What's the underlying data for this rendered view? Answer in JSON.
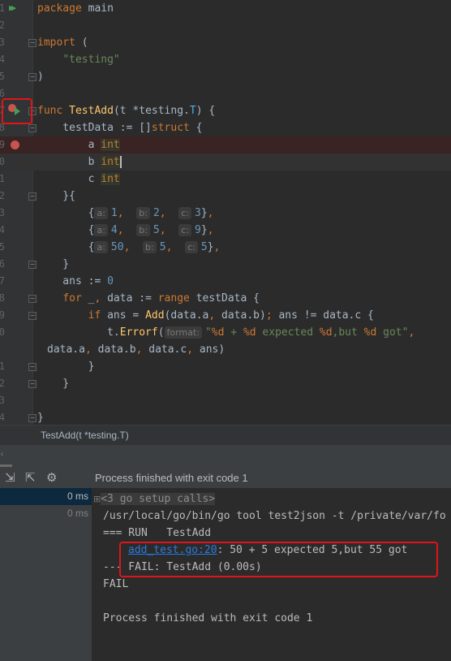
{
  "editor": {
    "lines": [
      {
        "num": "1",
        "tokens": [
          [
            "package ",
            "k"
          ],
          [
            "main",
            "t"
          ]
        ]
      },
      {
        "num": "2",
        "tokens": []
      },
      {
        "num": "3",
        "tokens": [
          [
            "import ",
            "k"
          ],
          [
            "(",
            "t"
          ]
        ]
      },
      {
        "num": "4",
        "tokens": [
          [
            "    ",
            "t"
          ],
          [
            "\"testing\"",
            "s"
          ]
        ]
      },
      {
        "num": "5",
        "tokens": [
          [
            ")",
            "t"
          ]
        ]
      },
      {
        "num": "6",
        "tokens": []
      },
      {
        "num": "7",
        "tokens": [
          [
            "func ",
            "k"
          ],
          [
            "TestAdd",
            "f"
          ],
          [
            "(t *testing.",
            "t"
          ],
          [
            "T",
            "tt"
          ],
          [
            ") {",
            "t"
          ]
        ]
      },
      {
        "num": "8",
        "tokens": [
          [
            "    testData := []",
            "t"
          ],
          [
            "struct",
            "k"
          ],
          [
            " {",
            "t"
          ]
        ]
      },
      {
        "num": "9",
        "tokens": [
          [
            "        a ",
            "t"
          ],
          [
            "int",
            "ty"
          ]
        ]
      },
      {
        "num": "0",
        "tokens": [
          [
            "        b ",
            "t"
          ],
          [
            "int",
            "ty"
          ]
        ]
      },
      {
        "num": "1",
        "tokens": [
          [
            "        c ",
            "t"
          ],
          [
            "int",
            "ty"
          ]
        ]
      },
      {
        "num": "2",
        "tokens": [
          [
            "    }{",
            "t"
          ]
        ]
      },
      {
        "num": "3",
        "tokens": [
          [
            "        {",
            "t"
          ],
          [
            "a:",
            "h"
          ],
          [
            "1",
            "n"
          ],
          [
            ",  ",
            "k"
          ],
          [
            "b:",
            "h"
          ],
          [
            "2",
            "n"
          ],
          [
            ",  ",
            "k"
          ],
          [
            "c:",
            "h"
          ],
          [
            "3",
            "n"
          ],
          [
            "}",
            "t"
          ],
          [
            ",",
            "k"
          ]
        ]
      },
      {
        "num": "4",
        "tokens": [
          [
            "        {",
            "t"
          ],
          [
            "a:",
            "h"
          ],
          [
            "4",
            "n"
          ],
          [
            ",  ",
            "k"
          ],
          [
            "b:",
            "h"
          ],
          [
            "5",
            "n"
          ],
          [
            ",  ",
            "k"
          ],
          [
            "c:",
            "h"
          ],
          [
            "9",
            "n"
          ],
          [
            "}",
            "t"
          ],
          [
            ",",
            "k"
          ]
        ]
      },
      {
        "num": "5",
        "tokens": [
          [
            "        {",
            "t"
          ],
          [
            "a:",
            "h"
          ],
          [
            "50",
            "n"
          ],
          [
            ",  ",
            "k"
          ],
          [
            "b:",
            "h"
          ],
          [
            "5",
            "n"
          ],
          [
            ",  ",
            "k"
          ],
          [
            "c:",
            "h"
          ],
          [
            "5",
            "n"
          ],
          [
            "}",
            "t"
          ],
          [
            ",",
            "k"
          ]
        ]
      },
      {
        "num": "6",
        "tokens": [
          [
            "    }",
            "t"
          ]
        ]
      },
      {
        "num": "7",
        "tokens": [
          [
            "    ans := ",
            "t"
          ],
          [
            "0",
            "n"
          ]
        ]
      },
      {
        "num": "8",
        "tokens": [
          [
            "    ",
            "t"
          ],
          [
            "for ",
            "k"
          ],
          [
            "_",
            "t"
          ],
          [
            ", ",
            "k"
          ],
          [
            "data := ",
            "t"
          ],
          [
            "range ",
            "k"
          ],
          [
            "testData {",
            "t"
          ]
        ]
      },
      {
        "num": "9",
        "tokens": [
          [
            "        ",
            "t"
          ],
          [
            "if ",
            "k"
          ],
          [
            "ans = ",
            "t"
          ],
          [
            "Add",
            "f"
          ],
          [
            "(data.a",
            "t"
          ],
          [
            ", ",
            "k"
          ],
          [
            "data.b)",
            "t"
          ],
          [
            "; ",
            "k"
          ],
          [
            "ans != data.c {",
            "t"
          ]
        ]
      },
      {
        "num": "0",
        "tokens": [
          [
            "           t.",
            "t"
          ],
          [
            "Errorf",
            "f"
          ],
          [
            "(",
            "t"
          ],
          [
            "format:",
            "h"
          ],
          [
            "\"",
            "s"
          ],
          [
            "%d",
            "k"
          ],
          [
            " + ",
            "s"
          ],
          [
            "%d",
            "k"
          ],
          [
            " expected ",
            "s"
          ],
          [
            "%d",
            "k"
          ],
          [
            ",but ",
            "s"
          ],
          [
            "%d",
            "k"
          ],
          [
            " got\"",
            "s"
          ],
          [
            ",",
            "k"
          ]
        ]
      },
      {
        "num": "",
        "wrap": true,
        "tokens": [
          [
            "data.a",
            "t"
          ],
          [
            ", ",
            "k"
          ],
          [
            "data.b",
            "t"
          ],
          [
            ", ",
            "k"
          ],
          [
            "data.c",
            "t"
          ],
          [
            ", ",
            "k"
          ],
          [
            "ans)",
            "t"
          ]
        ]
      },
      {
        "num": "1",
        "tokens": [
          [
            "        }",
            "t"
          ]
        ]
      },
      {
        "num": "2",
        "tokens": [
          [
            "    }",
            "t"
          ]
        ]
      },
      {
        "num": "3",
        "tokens": []
      },
      {
        "num": "4",
        "tokens": [
          [
            "}",
            "t"
          ]
        ]
      }
    ]
  },
  "breadcrumb": "TestAdd(t *testing.T)",
  "toolbar": {
    "status": "Process finished with exit code 1"
  },
  "tree": [
    {
      "label": "0 ms",
      "selected": true
    },
    {
      "label": "0 ms",
      "selected": false
    }
  ],
  "console": {
    "collapsed": "<3 go setup calls>",
    "cmd": "/usr/local/go/bin/go tool test2json -t /private/var/fo",
    "run": "=== RUN   TestAdd",
    "link": "add_test.go:20",
    "error": ": 50 + 5 expected 5,but 55 got",
    "fail_line": "--- FAIL: TestAdd (0.00s)",
    "fail": "FAIL",
    "exit": "Process finished with exit code 1"
  },
  "colors": {
    "keyword": "#cc7832",
    "string": "#6a8759",
    "number": "#6897bb",
    "function": "#ffc66d",
    "highlight_box": "#e0141a",
    "breakpoint": "#c75450"
  }
}
